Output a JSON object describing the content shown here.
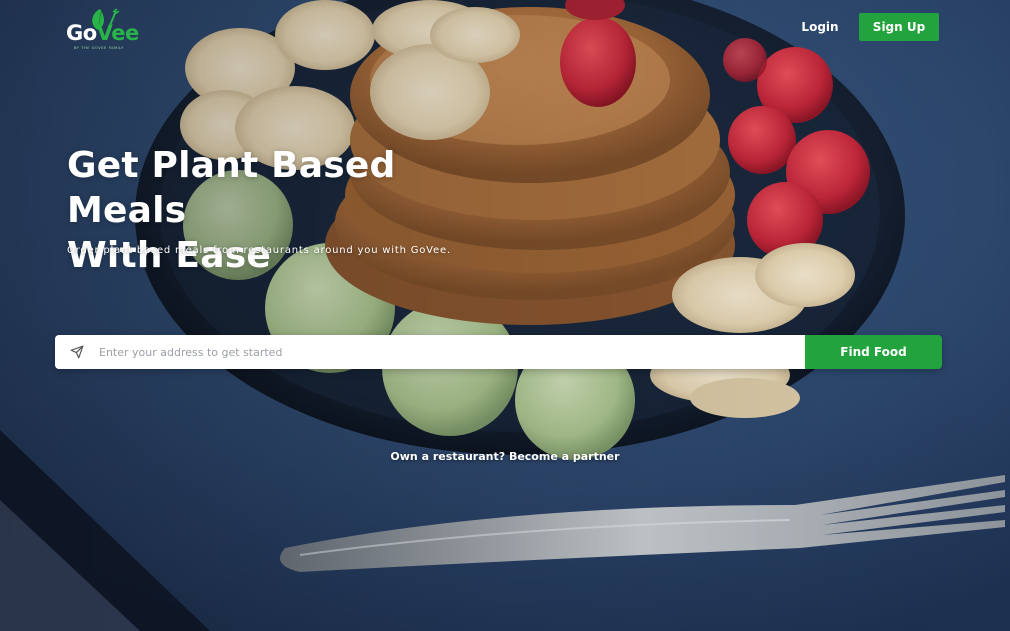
{
  "brand": {
    "logo_go": "Go",
    "logo_vee": "Vee",
    "tagline": "BY THE GOVEE FAMILY",
    "accent_color": "#22a33e"
  },
  "header": {
    "login_label": "Login",
    "signup_label": "Sign Up"
  },
  "hero": {
    "headline_line1": "Get Plant Based Meals",
    "headline_line2": "With Ease",
    "subtitle": "Order plant based meals from restaurants around you with GoVee."
  },
  "search": {
    "icon": "send-icon",
    "placeholder": "Enter your address to get started",
    "button_label": "Find Food"
  },
  "partner_link": "Own a restaurant? Become a partner"
}
